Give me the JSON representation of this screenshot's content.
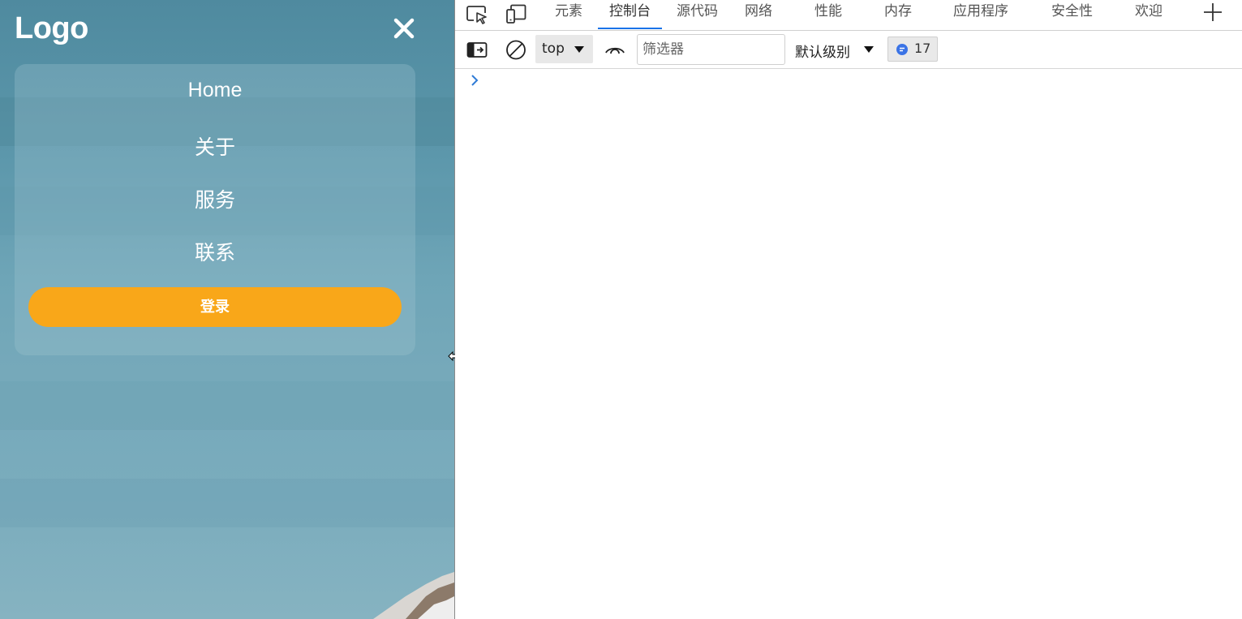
{
  "site": {
    "logo": "Logo",
    "nav": [
      {
        "label": "Home"
      },
      {
        "label": "关于"
      },
      {
        "label": "服务"
      },
      {
        "label": "联系"
      }
    ],
    "login_label": "登录",
    "accent_color": "#f9a719",
    "icons": {
      "close": "close-icon"
    }
  },
  "devtools": {
    "tabs": [
      {
        "label": "元素"
      },
      {
        "label": "控制台"
      },
      {
        "label": "源代码"
      },
      {
        "label": "网络"
      },
      {
        "label": "性能"
      },
      {
        "label": "内存"
      },
      {
        "label": "应用程序"
      },
      {
        "label": "安全性"
      },
      {
        "label": "欢迎"
      }
    ],
    "active_tab": "控制台",
    "toolbar": {
      "context": "top",
      "filter_placeholder": "筛选器",
      "level": "默认级别",
      "issues_count": "17"
    },
    "accent_color": "#1a73e8",
    "icons": {
      "inspect": "inspect-element-icon",
      "device": "device-toolbar-icon",
      "add": "plus-icon",
      "sidebar": "console-sidebar-icon",
      "clear": "clear-console-icon",
      "eye": "live-expression-icon",
      "issues": "issues-message-icon",
      "prompt": "console-prompt-chevron-icon"
    }
  }
}
